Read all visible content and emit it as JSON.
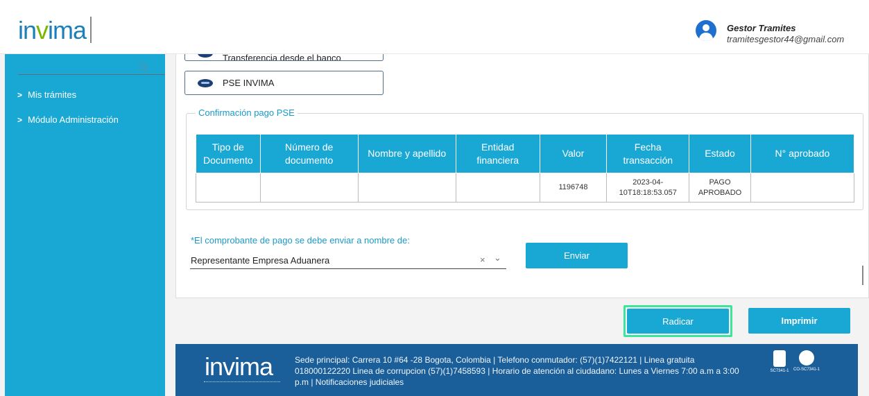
{
  "header": {
    "logo_text": "invima",
    "user_name": "Gestor Tramites",
    "user_email": "tramitesgestor44@gmail.com"
  },
  "sidebar": {
    "items": [
      {
        "label": "Mis trámites"
      },
      {
        "label": "Módulo Administración"
      }
    ]
  },
  "payment_options": {
    "bank_transfer": "Transferencia desde el banco",
    "pse": "PSE INVIMA"
  },
  "pse_confirmation": {
    "legend": "Confirmación pago PSE",
    "columns": [
      "Tipo de Documento",
      "Número de documento",
      "Nombre y apellido",
      "Entidad financiera",
      "Valor",
      "Fecha transacción",
      "Estado",
      "N° aprobado"
    ],
    "rows": [
      [
        "",
        "",
        "",
        "",
        "1196748",
        "2023-04-10T18:18:53.057",
        "PAGO APROBADO",
        ""
      ]
    ]
  },
  "receipt": {
    "label": "*El comprobante de pago se debe enviar a nombre de:",
    "selected": "Representante Empresa Aduanera",
    "clear_glyph": "×",
    "chevron_glyph": "⌄",
    "send_button": "Enviar"
  },
  "actions": {
    "radicar": "Radicar",
    "imprimir": "Imprimir"
  },
  "footer": {
    "logo_text": "invima",
    "text": "Sede principal: Carrera 10 #64 -28 Bogota, Colombia | Telefono conmutador: (57)(1)7422121 | Linea gratuita 018000122220 Linea de corrupcion (57)(1)7458593 | Horario de atención al ciudadano: Lunes a Viernes 7:00 a.m a 3:00 p.m | Notificaciones judiciales",
    "cert_1": "SC7341-1",
    "cert_2": "CO-SC7341-1"
  },
  "colors": {
    "primary": "#19a7d4",
    "footer": "#1b5f9a",
    "highlight": "#3de49c",
    "brand_green": "#7ab800"
  }
}
